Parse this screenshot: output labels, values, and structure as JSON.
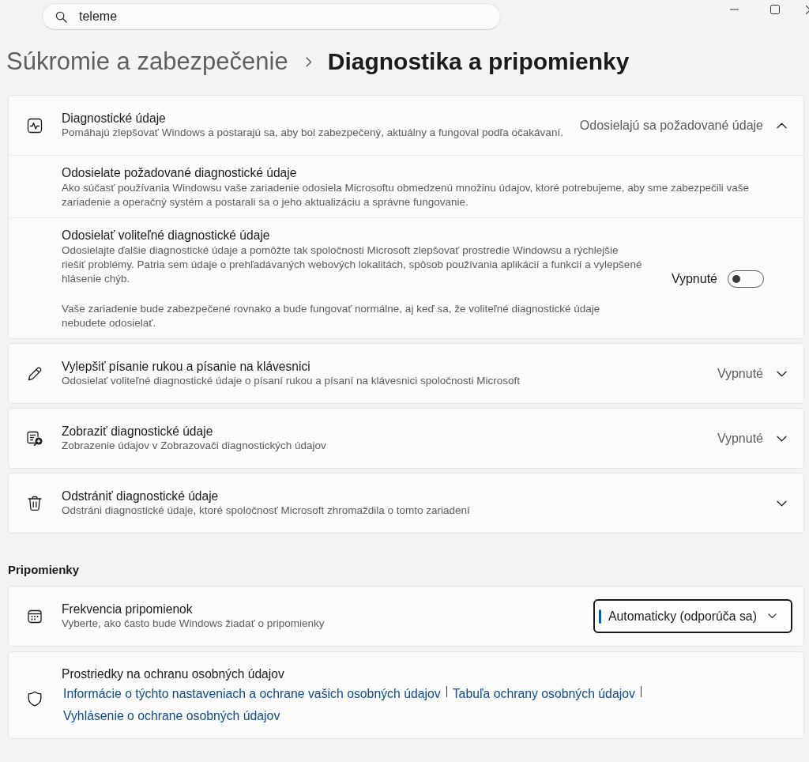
{
  "search": {
    "value": "teleme"
  },
  "breadcrumb": {
    "parent": "Súkromie a zabezpečenie",
    "current": "Diagnostika a pripomienky"
  },
  "diagnostics_cards": [
    {
      "title": "Diagnostické údaje",
      "description": "Pomáhajú zlepšovať Windows a postarajú sa, aby bol zabezpečený, aktuálny a fungoval podľa očakávaní.",
      "status": "Odosielajú sa požadované údaje",
      "expanded": true,
      "items": [
        {
          "kind": "info",
          "title": "Odosielate požadované diagnostické údaje",
          "paragraphs": [
            "Ako súčasť používania Windowsu vaše zariadenie odosiela Microsoftu obmedzenú množinu údajov, ktoré potrebujeme, aby sme zabezpečili vaše zariadenie a operačný systém a postarali sa o jeho aktualizáciu a správne fungovanie."
          ]
        },
        {
          "kind": "toggle",
          "title": "Odosielať voliteľné diagnostické údaje",
          "paragraphs": [
            "Odosielajte ďalšie diagnostické údaje a pomôžte tak spoločnosti Microsoft zlepšovať prostredie Windowsu a rýchlejšie riešiť problémy. Patria sem údaje o prehľadávaných webových lokalitách, spôsob používania aplikácií a funkcií a vylepšené hlásenie chýb.",
            "Vaše zariadenie bude zabezpečené rovnako a bude fungovať normálne, aj keď sa, že voliteľné diagnostické údaje nebudete odosielať."
          ],
          "toggle": {
            "label": "Vypnuté",
            "on": false
          }
        }
      ]
    },
    {
      "title": "Vylepšiť písanie rukou a písanie na klávesnici",
      "description": "Odosielať voliteľné diagnostické údaje o písaní rukou a písaní na klávesnici spoločnosti Microsoft",
      "status": "Vypnuté",
      "expanded": false
    },
    {
      "title": "Zobraziť diagnostické údaje",
      "description": "Zobrazenie údajov v Zobrazovači diagnostických údajov",
      "status": "Vypnuté",
      "expanded": false
    },
    {
      "title": "Odstrániť diagnostické údaje",
      "description": "Odstráni diagnostické údaje, ktoré spoločnosť Microsoft zhromaždila o tomto zariadení",
      "expanded": false
    }
  ],
  "feedback": {
    "heading": "Pripomienky",
    "frequency": {
      "title": "Frekvencia pripomienok",
      "description": "Vyberte, ako často bude Windows žiadať o pripomienky",
      "dropdown": {
        "value": "Automaticky (odporúča sa)",
        "focused": true
      }
    }
  },
  "privacy": {
    "title": "Prostriedky na ochranu osobných údajov",
    "links": [
      "Informácie o týchto nastaveniach a ochrane vašich osobných údajov",
      "Tabuľa ochrany osobných údajov",
      "Vyhlásenie o ochrane osobných údajov"
    ]
  }
}
